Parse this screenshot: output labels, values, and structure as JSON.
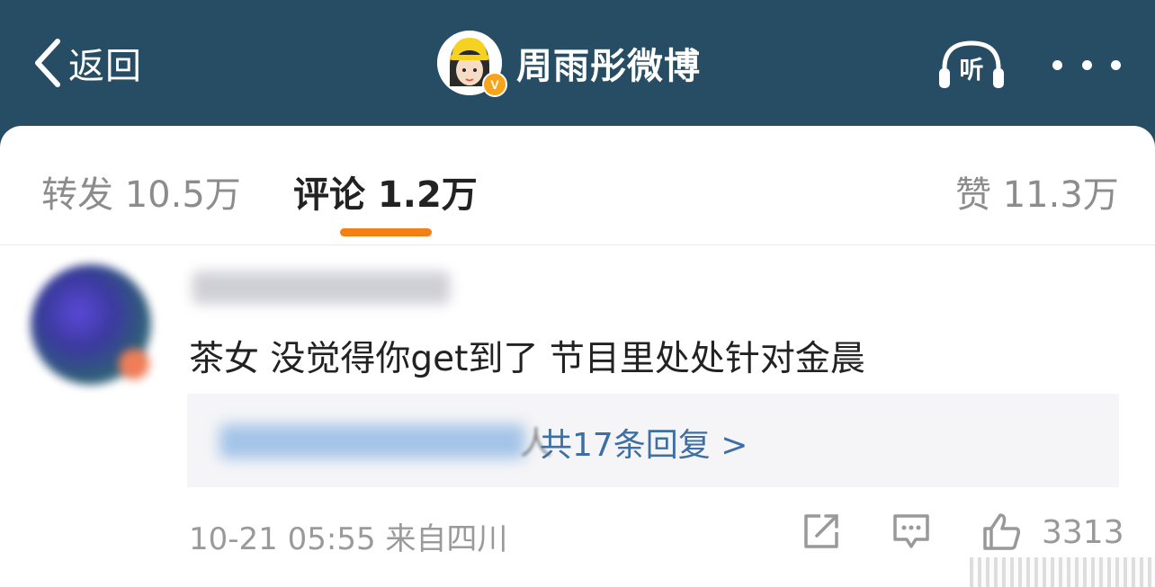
{
  "header": {
    "back_label": "返回",
    "title": "周雨彤微博",
    "verified_badge": "V",
    "listen_label": "听",
    "icons": [
      "chevron-left-icon",
      "headphones-icon",
      "more-icon"
    ]
  },
  "tabs": [
    {
      "label": "转发 10.5万"
    },
    {
      "label": "评论 1.2万",
      "active": true
    },
    {
      "label": "赞 11.3万"
    }
  ],
  "comment": {
    "text": "茶女 没觉得你get到了 节目里处处针对金晨",
    "replies_label": "共17条回复 >",
    "reply_people_suffix": "人",
    "meta": "10-21 05:55 来自四川",
    "like_count": "3313"
  },
  "colors": {
    "header_bg": "#264d63",
    "tab_indicator": "#f47f13",
    "reply_link": "#3d6fa4",
    "verified_badge": "#f7a41a"
  }
}
